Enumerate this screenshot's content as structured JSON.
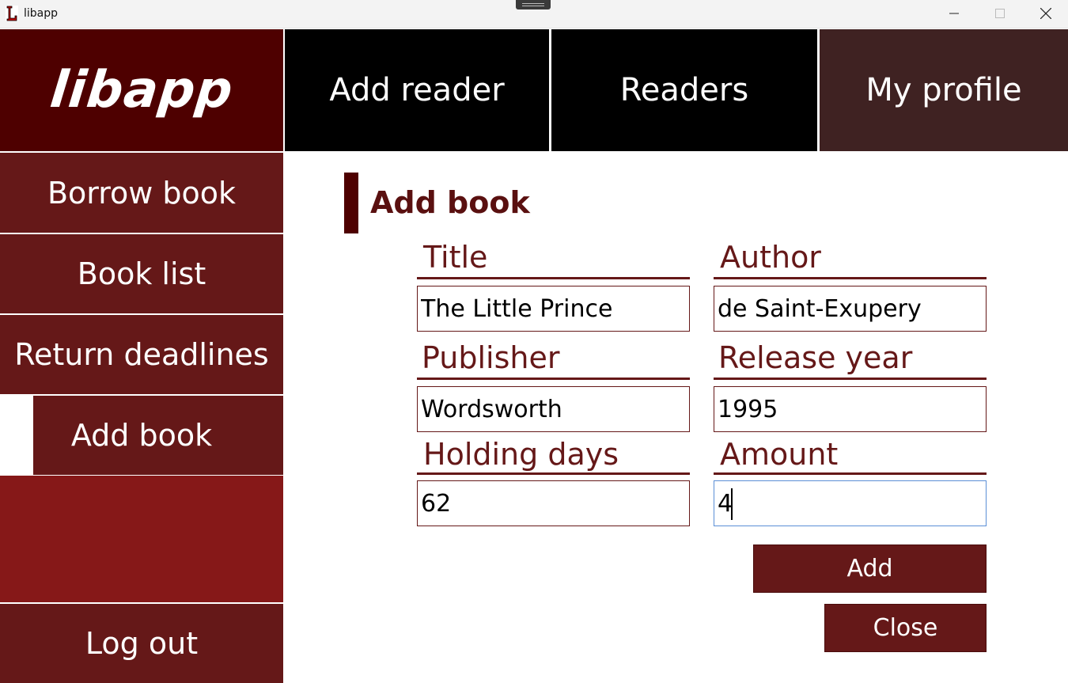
{
  "window": {
    "title": "libapp",
    "controls": [
      "minimize-icon",
      "maximize-icon",
      "close-icon"
    ]
  },
  "header": {
    "logo": "libapp",
    "nav": [
      {
        "label": "Add reader"
      },
      {
        "label": "Readers"
      },
      {
        "label": "My profile"
      }
    ]
  },
  "sidebar": {
    "items": [
      {
        "label": "Borrow book"
      },
      {
        "label": "Book list"
      },
      {
        "label": "Return deadlines"
      },
      {
        "label": "Add book",
        "active": true
      }
    ],
    "logout": "Log out"
  },
  "form": {
    "title": "Add book",
    "fields": [
      {
        "label": "Title",
        "value": "The Little Prince"
      },
      {
        "label": "Author",
        "value": "de Saint-Exupery"
      },
      {
        "label": "Publisher",
        "value": "Wordsworth"
      },
      {
        "label": "Release year",
        "value": "1995"
      },
      {
        "label": "Holding days",
        "value": "62"
      },
      {
        "label": "Amount",
        "value": "4",
        "focused": true
      }
    ],
    "add_label": "Add",
    "close_label": "Close"
  },
  "colors": {
    "brand_dark": "#4e0000",
    "brand": "#651818",
    "sidebar_fill": "#861818",
    "nav_black": "#000000",
    "nav_active": "#3f2222"
  }
}
